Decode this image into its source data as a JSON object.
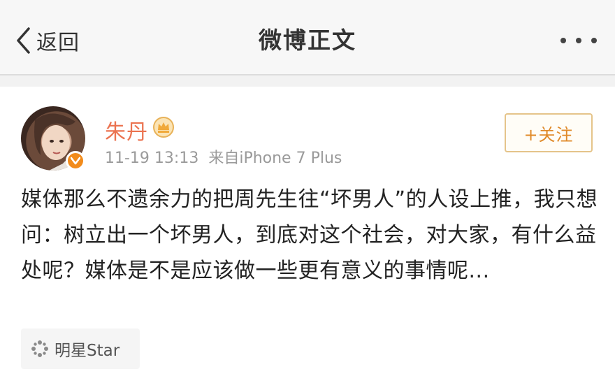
{
  "navbar": {
    "back_label": "返回",
    "title": "微博正文",
    "more_icon": "more-horizontal-icon"
  },
  "post": {
    "author": "朱丹",
    "timestamp": "11-19 13:13",
    "source": "来自iPhone 7 Plus",
    "follow_label": "+关注",
    "content": "媒体那么不遗余力的把周先生往“坏男人”的人设上推，我只想问：树立出一个坏男人，到底对这个社会，对大家，有什么益处呢？媒体是不是应该做一些更有意义的事情呢...",
    "topic": "明星Star"
  },
  "colors": {
    "username": "#eb7350",
    "follow_border": "#e5c48a",
    "follow_text": "#e08a2a",
    "verified_badge": "#f28b1b",
    "meta_text": "#9a9a9a"
  }
}
